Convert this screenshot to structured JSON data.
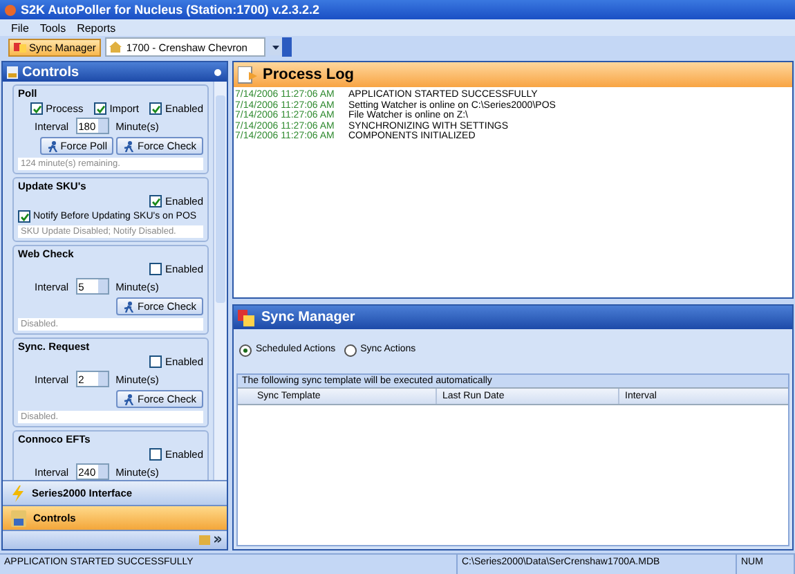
{
  "window": {
    "title": "S2K AutoPoller for Nucleus (Station:1700) v.2.3.2.2"
  },
  "menu": [
    "File",
    "Tools",
    "Reports"
  ],
  "toolbar": {
    "button": {
      "label": "Sync Manager",
      "selected": true
    },
    "station": {
      "value": "1700 - Crenshaw Chevron"
    }
  },
  "controls_panel": {
    "title": "Controls",
    "groups": [
      {
        "title": "Poll",
        "checkboxes": [
          {
            "label": "Process",
            "checked": true
          },
          {
            "label": "Import",
            "checked": true
          },
          {
            "label": "Enabled",
            "checked": true
          }
        ],
        "interval": {
          "label": "Interval",
          "value": "180",
          "unit": "Minute(s)"
        },
        "buttons": [
          "Force Poll",
          "Force Check"
        ],
        "status": "124 minute(s) remaining."
      },
      {
        "title": "Update SKU's",
        "checkboxes": [
          {
            "label": "Enabled",
            "checked": true
          },
          {
            "label": "Notify Before Updating SKU's on POS",
            "checked": true
          }
        ],
        "status": "SKU Update Disabled; Notify Disabled."
      },
      {
        "title": "Web Check",
        "checkboxes": [
          {
            "label": "Enabled",
            "checked": false
          }
        ],
        "interval": {
          "label": "Interval",
          "value": "5",
          "unit": "Minute(s)"
        },
        "buttons": [
          "Force Check"
        ],
        "status": "Disabled."
      },
      {
        "title": "Sync. Request",
        "checkboxes": [
          {
            "label": "Enabled",
            "checked": false
          }
        ],
        "interval": {
          "label": "Interval",
          "value": "2",
          "unit": "Minute(s)"
        },
        "buttons": [
          "Force Check"
        ],
        "status": "Disabled."
      },
      {
        "title": "Connoco EFTs",
        "checkboxes": [
          {
            "label": "Enabled",
            "checked": false
          }
        ],
        "interval": {
          "label": "Interval",
          "value": "240",
          "unit": "Minute(s)"
        }
      }
    ]
  },
  "navigation": [
    {
      "label": "Series2000 Interface",
      "selected": false
    },
    {
      "label": "Controls",
      "selected": true
    }
  ],
  "process_log": {
    "title": "Process Log",
    "entries": [
      {
        "time": "7/14/2006 11:27:06 AM",
        "message": "APPLICATION STARTED SUCCESSFULLY"
      },
      {
        "time": "7/14/2006 11:27:06 AM",
        "message": "Setting Watcher is online on C:\\Series2000\\POS"
      },
      {
        "time": "7/14/2006 11:27:06 AM",
        "message": "File Watcher is online on Z:\\"
      },
      {
        "time": "7/14/2006 11:27:06 AM",
        "message": "SYNCHRONIZING WITH SETTINGS"
      },
      {
        "time": "7/14/2006 11:27:06 AM",
        "message": "COMPONENTS INITIALIZED"
      }
    ]
  },
  "sync_manager": {
    "title": "Sync Manager",
    "options": [
      {
        "label": "Scheduled Actions",
        "selected": true
      },
      {
        "label": "Sync Actions",
        "selected": false
      }
    ],
    "table": {
      "caption": "The following sync template will be executed automatically",
      "columns": [
        "Sync Template",
        "Last Run Date",
        "Interval"
      ]
    }
  },
  "status_bar": [
    "APPLICATION STARTED SUCCESSFULLY",
    "C:\\Series2000\\Data\\SerCrenshaw1700A.MDB",
    "NUM"
  ]
}
